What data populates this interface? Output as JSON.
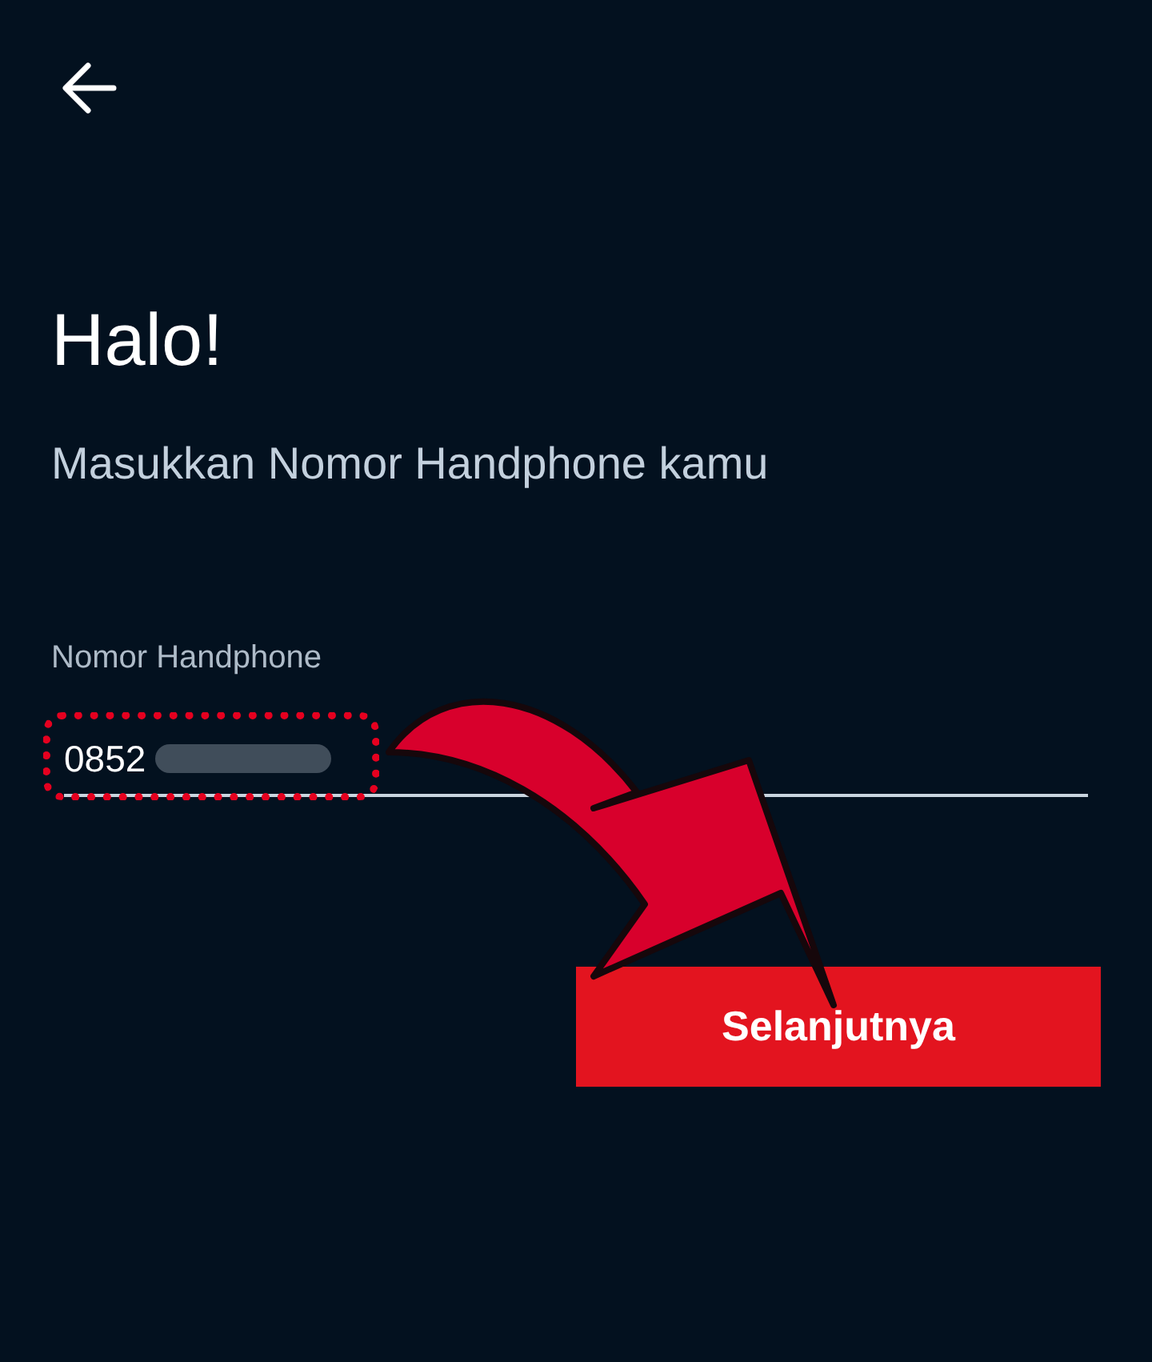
{
  "title": "Halo!",
  "subtitle": "Masukkan Nomor Handphone kamu",
  "phone_field": {
    "label": "Nomor Handphone",
    "value": "0852"
  },
  "next_button": {
    "label": "Selanjutnya"
  }
}
